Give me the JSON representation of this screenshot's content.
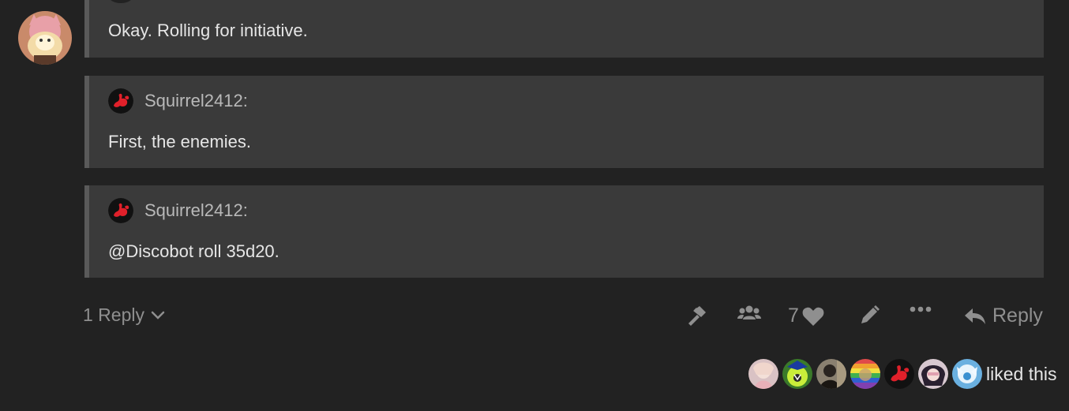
{
  "post": {
    "author_avatar": "user-avatar-fox-girl",
    "quotes": [
      {
        "text": "Okay. Rolling for initiative."
      },
      {
        "author": "Squirrel2412:",
        "avatar_icon": "squirrel-icon",
        "text": "First, the enemies."
      },
      {
        "author": "Squirrel2412:",
        "avatar_icon": "squirrel-icon",
        "text": "@Discobot roll 35d20."
      }
    ]
  },
  "controls": {
    "replies_label": "1 Reply",
    "like_count": "7",
    "reply_label": "Reply",
    "icons": [
      "wrench-icon",
      "group-icon",
      "heart-icon",
      "pencil-icon",
      "more-icon",
      "reply-icon"
    ]
  },
  "likes": {
    "label": "liked this",
    "count_avatars": 7
  },
  "colors": {
    "background": "#222222",
    "quote_bg": "#3a3a3a",
    "quote_border": "#5a5a5a",
    "muted": "#8f8f8f",
    "squirrel_red": "#e0202a"
  }
}
